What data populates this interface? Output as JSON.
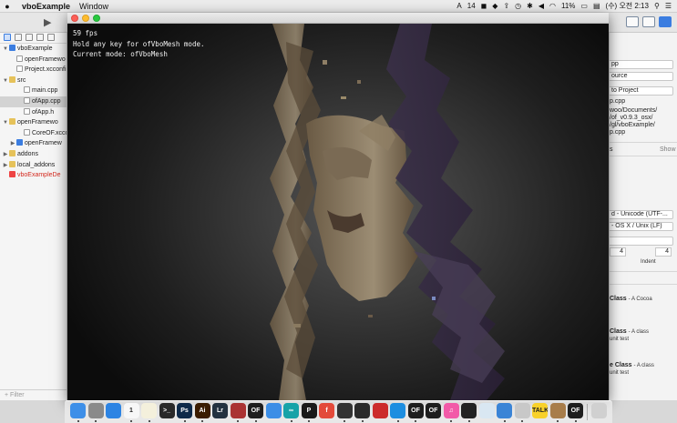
{
  "menubar": {
    "apple_icon": "apple-logo-icon",
    "app_name": "vboExample",
    "menus": [
      "Window"
    ],
    "status": {
      "input_method": "A",
      "notification_count": "14",
      "battery": "11%",
      "clock": "(수) 오전 2:13"
    }
  },
  "navigator": {
    "items": [
      {
        "label": "vboExample",
        "kind": "proj",
        "disclosure": "▼",
        "indent": 0
      },
      {
        "label": "openFramewo",
        "kind": "file",
        "disclosure": "",
        "indent": 1
      },
      {
        "label": "Project.xcconfi",
        "kind": "file",
        "disclosure": "",
        "indent": 1
      },
      {
        "label": "src",
        "kind": "folder",
        "disclosure": "▼",
        "indent": 0
      },
      {
        "label": "main.cpp",
        "kind": "file",
        "disclosure": "",
        "indent": 2
      },
      {
        "label": "ofApp.cpp",
        "kind": "file",
        "disclosure": "",
        "indent": 2,
        "selected": true
      },
      {
        "label": "ofApp.h",
        "kind": "file",
        "disclosure": "",
        "indent": 2
      },
      {
        "label": "openFramewo",
        "kind": "folder",
        "disclosure": "▼",
        "indent": 0
      },
      {
        "label": "CoreOF.xcco",
        "kind": "file",
        "disclosure": "",
        "indent": 2
      },
      {
        "label": "openFramew",
        "kind": "proj",
        "disclosure": "▶",
        "indent": 1
      },
      {
        "label": "addons",
        "kind": "folder",
        "disclosure": "▶",
        "indent": 0
      },
      {
        "label": "local_addons",
        "kind": "folder",
        "disclosure": "▶",
        "indent": 0
      },
      {
        "label": "vboExampleDe",
        "kind": "app",
        "disclosure": "",
        "indent": 0,
        "red": true
      }
    ],
    "filter_placeholder": "Filter"
  },
  "inspector": {
    "name_field": "pp",
    "type_field": "ource",
    "location_field": "to Project",
    "filename": "p.cpp",
    "path_lines": [
      "woo/Documents/",
      "/of_v0.9.3_osx/",
      "/gl/vboExample/",
      "p.cpp"
    ],
    "section_targets": "s",
    "show_link": "Show",
    "encoding": "d - Unicode (UTF-...",
    "line_endings": "- OS X / Unix (LF)",
    "tab_width": "4",
    "indent_width": "4",
    "indent_label": "Indent",
    "templates": [
      {
        "title": "Class",
        "desc": "- A Cocoa"
      },
      {
        "title": "Class",
        "desc": "- A class",
        "desc2": "unit test"
      },
      {
        "title": "e Class",
        "desc": "- A class",
        "desc2": "unit test"
      }
    ]
  },
  "app_window": {
    "overlay_lines": [
      "59 fps",
      "Hold any key for ofVboMesh mode.",
      "Current mode: ofVboMesh"
    ]
  },
  "dock": {
    "icons": [
      {
        "name": "finder-icon",
        "label": "",
        "color": "#3d8fe8"
      },
      {
        "name": "launchpad-icon",
        "label": "",
        "color": "#8a8a8a"
      },
      {
        "name": "safari-icon",
        "label": "",
        "color": "#2d84e3"
      },
      {
        "name": "calendar-icon",
        "label": "1",
        "color": "#f7f7f7"
      },
      {
        "name": "notes-icon",
        "label": "",
        "color": "#f4f0dc"
      },
      {
        "name": "terminal-icon",
        "label": ">_",
        "color": "#2a2a2a"
      },
      {
        "name": "photoshop-icon",
        "label": "Ps",
        "color": "#0e2a4a"
      },
      {
        "name": "illustrator-icon",
        "label": "Ai",
        "color": "#3a1c00"
      },
      {
        "name": "lightroom-icon",
        "label": "Lr",
        "color": "#233240"
      },
      {
        "name": "app-grid-icon",
        "label": "",
        "color": "#a33"
      },
      {
        "name": "openframeworks-icon",
        "label": "OF",
        "color": "#1e1e1e"
      },
      {
        "name": "app-store-icon",
        "label": "",
        "color": "#3c8ee6"
      },
      {
        "name": "arduino-icon",
        "label": "∞",
        "color": "#16a3a8"
      },
      {
        "name": "processing-icon",
        "label": "P",
        "color": "#1a1a1a"
      },
      {
        "name": "sublime-f-icon",
        "label": "f",
        "color": "#e34a3a"
      },
      {
        "name": "brackets-icon",
        "label": "",
        "color": "#333"
      },
      {
        "name": "dark-app-icon",
        "label": "",
        "color": "#2a2a2a"
      },
      {
        "name": "red-arrow-icon",
        "label": "",
        "color": "#cc2b2b"
      },
      {
        "name": "blue-app-icon",
        "label": "",
        "color": "#1d8ee0"
      },
      {
        "name": "openframeworks-icon-2",
        "label": "OF",
        "color": "#1e1e1e"
      },
      {
        "name": "openframeworks-icon-3",
        "label": "OF",
        "color": "#1e1e1e"
      },
      {
        "name": "itunes-icon",
        "label": "♫",
        "color": "#f25aa8"
      },
      {
        "name": "quicktime-icon",
        "label": "",
        "color": "#222"
      },
      {
        "name": "preview-icon",
        "label": "",
        "color": "#d9e7f2"
      },
      {
        "name": "finder-stack-icon",
        "label": "",
        "color": "#3a84d6"
      },
      {
        "name": "image-app-icon",
        "label": "",
        "color": "#c8c8c8"
      },
      {
        "name": "talk-icon",
        "label": "TALK",
        "color": "#f8d12a"
      },
      {
        "name": "downloads-folder-icon",
        "label": "",
        "color": "#a87d4a"
      },
      {
        "name": "openframeworks-icon-4",
        "label": "OF",
        "color": "#1e1e1e"
      },
      {
        "name": "trash-icon",
        "label": "",
        "color": "#d0d0d0"
      }
    ]
  }
}
